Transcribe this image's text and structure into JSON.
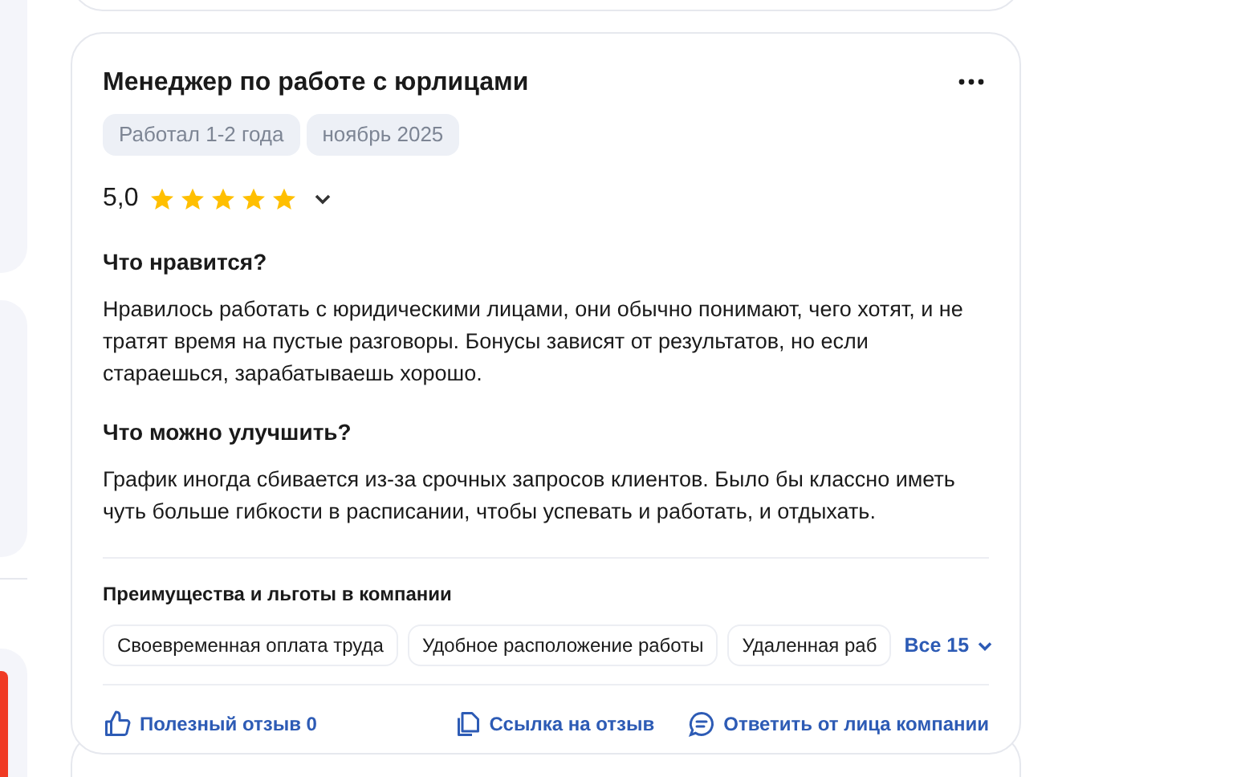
{
  "review": {
    "title": "Менеджер по работе с юрлицами",
    "tags": [
      "Работал 1-2 года",
      "ноябрь 2025"
    ],
    "rating": "5,0",
    "stars": 5,
    "sections": [
      {
        "heading": "Что нравится?",
        "text": "Нравилось работать с юридическими лицами, они обычно понимают, чего хотят, и не тратят время на пустые разговоры. Бонусы зависят от результатов, но если стараешься, зарабатываешь хорошо."
      },
      {
        "heading": "Что можно улучшить?",
        "text": "График иногда сбивается из-за срочных запросов клиентов. Было бы классно иметь чуть больше гибкости в расписании, чтобы успевать и работать, и отдыхать."
      }
    ],
    "benefits": {
      "heading": "Преимущества и льготы в компании",
      "items": [
        "Своевременная оплата труда",
        "Удобное расположение работы",
        "Удаленная раб"
      ],
      "more": "Все 15"
    },
    "actions": [
      {
        "kind": "like",
        "label": "Полезный отзыв 0"
      },
      {
        "kind": "copy",
        "label": "Ссылка на отзыв"
      },
      {
        "kind": "reply",
        "label": "Ответить от лица компании"
      }
    ]
  }
}
